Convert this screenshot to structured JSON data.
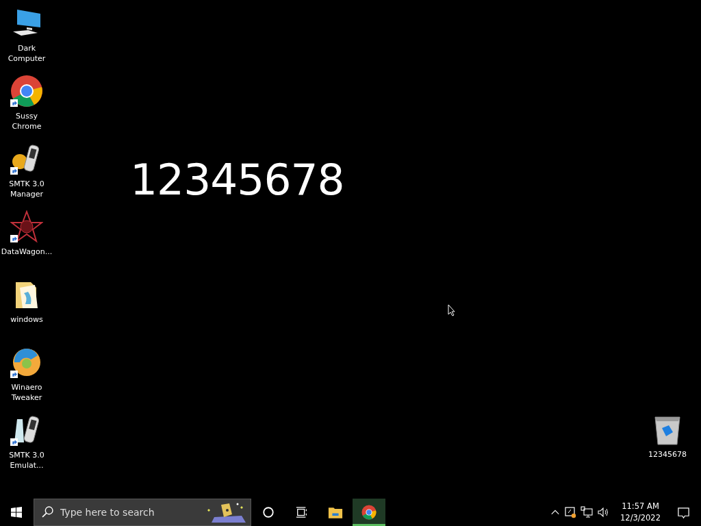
{
  "desktop_icons": [
    {
      "label": "Dark Computer",
      "kind": "computer",
      "shortcut": false
    },
    {
      "label": "Sussy Chrome",
      "kind": "chrome",
      "shortcut": true
    },
    {
      "label": "SMTK 3.0 Manager",
      "kind": "smtk-manager",
      "shortcut": true
    },
    {
      "label": "DataWagon...",
      "kind": "datawagon",
      "shortcut": true
    },
    {
      "label": "windows",
      "kind": "folder",
      "shortcut": false
    },
    {
      "label": "Winaero Tweaker",
      "kind": "winaero",
      "shortcut": true
    },
    {
      "label": "SMTK 3.0 Emulat...",
      "kind": "smtk-emulator",
      "shortcut": true
    }
  ],
  "recycle_bin": {
    "label": "12345678"
  },
  "desktop_text": "12345678",
  "taskbar": {
    "search": {
      "placeholder": "Type here to search"
    },
    "apps": [
      {
        "kind": "cortana",
        "selected": false
      },
      {
        "kind": "task-view",
        "selected": false
      },
      {
        "kind": "explorer",
        "selected": false
      },
      {
        "kind": "chrome",
        "selected": true
      }
    ],
    "clock": {
      "time": "11:57 AM",
      "date": "12/3/2022"
    }
  }
}
